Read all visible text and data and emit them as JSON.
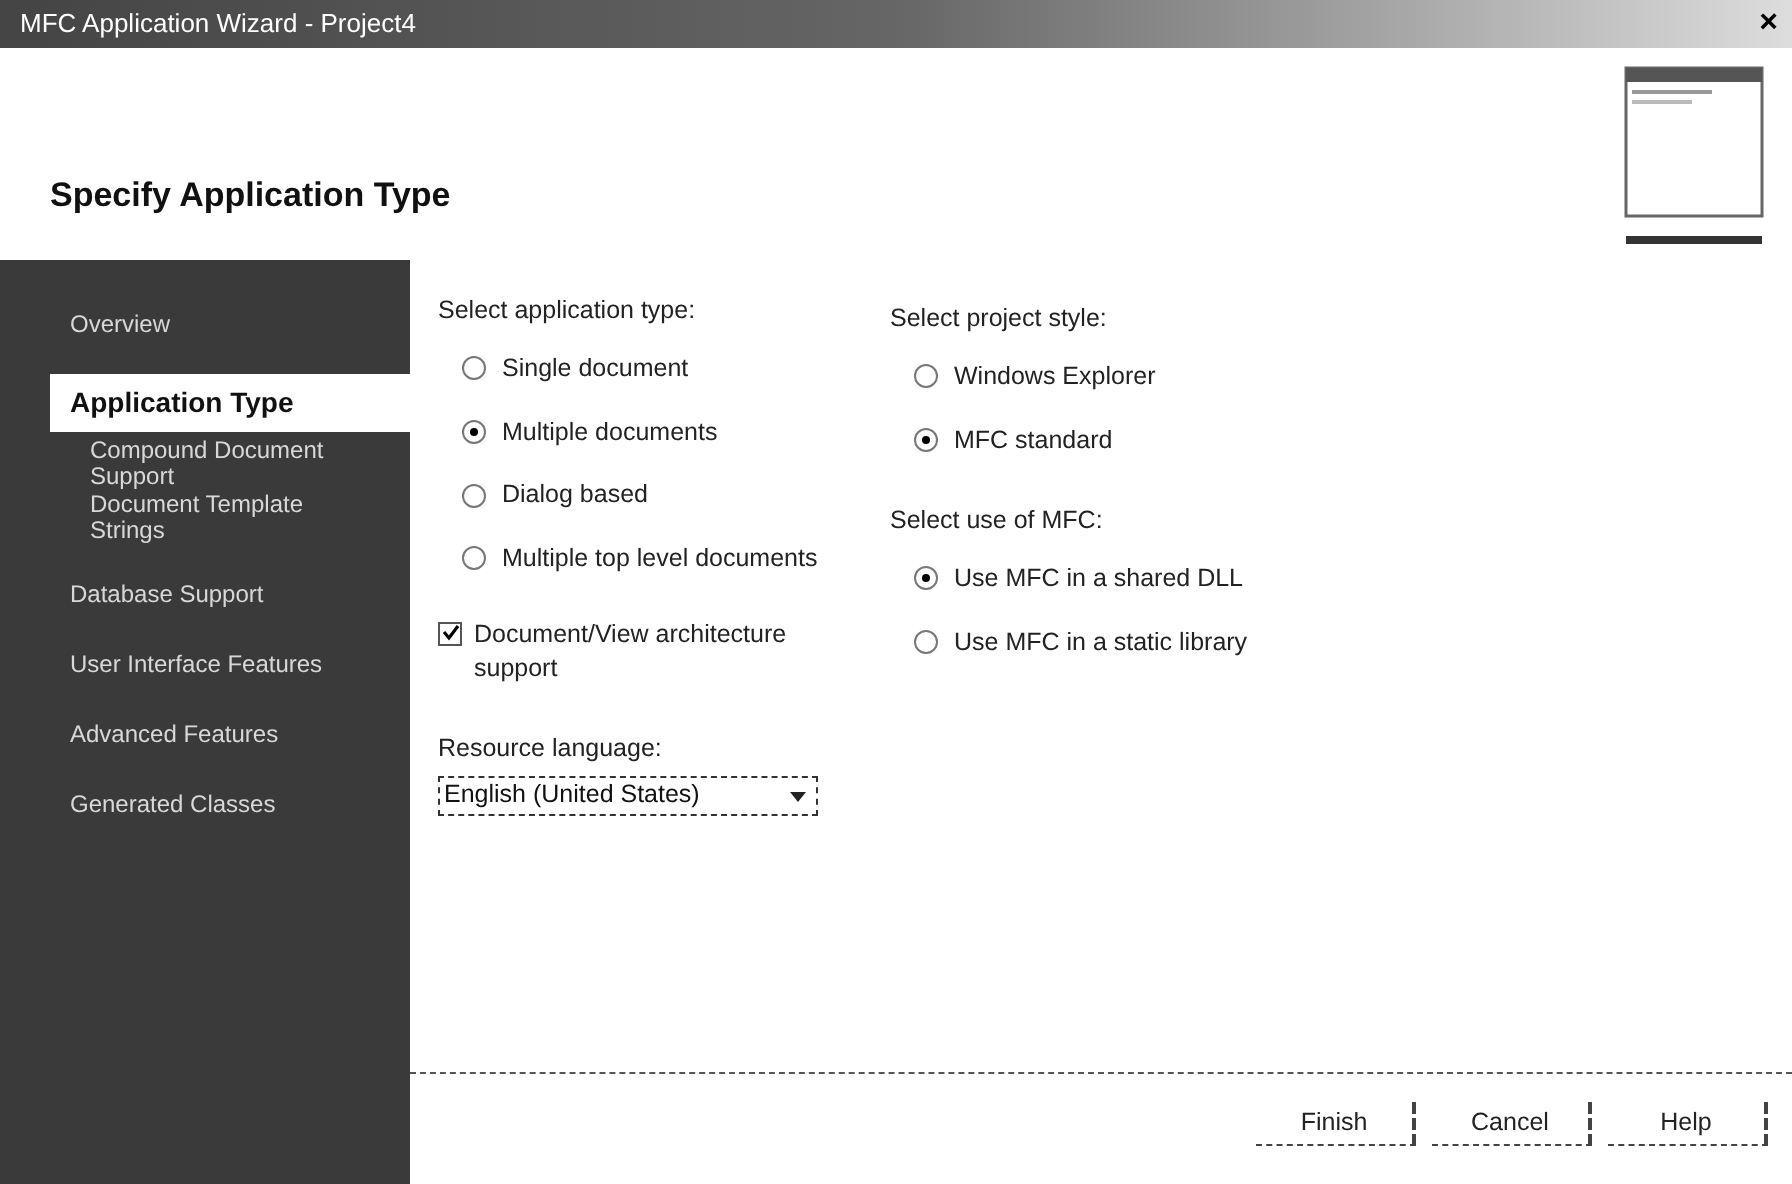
{
  "window": {
    "title": "MFC Application Wizard - Project4",
    "close": "×"
  },
  "header": {
    "title": "Specify Application Type"
  },
  "sidebar": {
    "items": [
      {
        "label": "Overview",
        "selected": false
      },
      {
        "label": "Application Type",
        "selected": true,
        "children": [
          {
            "label": "Compound Document Support",
            "selected": false
          },
          {
            "label": "Document Template Strings",
            "selected": false
          }
        ]
      },
      {
        "label": "Database Support",
        "selected": false
      },
      {
        "label": "User Interface Features",
        "selected": false
      },
      {
        "label": "Advanced Features",
        "selected": false
      },
      {
        "label": "Generated Classes",
        "selected": false
      }
    ]
  },
  "application_type": {
    "label": "Select application type:",
    "options": [
      {
        "label": "Single document",
        "selected": false
      },
      {
        "label": "Multiple documents",
        "selected": true
      },
      {
        "label": "Dialog based",
        "selected": false
      },
      {
        "label": "Multiple top level documents",
        "selected": false
      }
    ]
  },
  "doc_view": {
    "label": "Document/View architecture support",
    "checked": true
  },
  "resource_language": {
    "label": "Resource language:",
    "value": "English (United States)"
  },
  "project_style": {
    "label": "Select project style:",
    "options": [
      {
        "label": "Windows Explorer",
        "selected": false
      },
      {
        "label": "MFC standard",
        "selected": true
      }
    ]
  },
  "mfc_use": {
    "label": "Select use of MFC:",
    "options": [
      {
        "label": "Use MFC in a shared DLL",
        "selected": true
      },
      {
        "label": "Use MFC in a static library",
        "selected": false
      }
    ]
  },
  "buttons": [
    "Finish",
    "Cancel",
    "Help"
  ]
}
